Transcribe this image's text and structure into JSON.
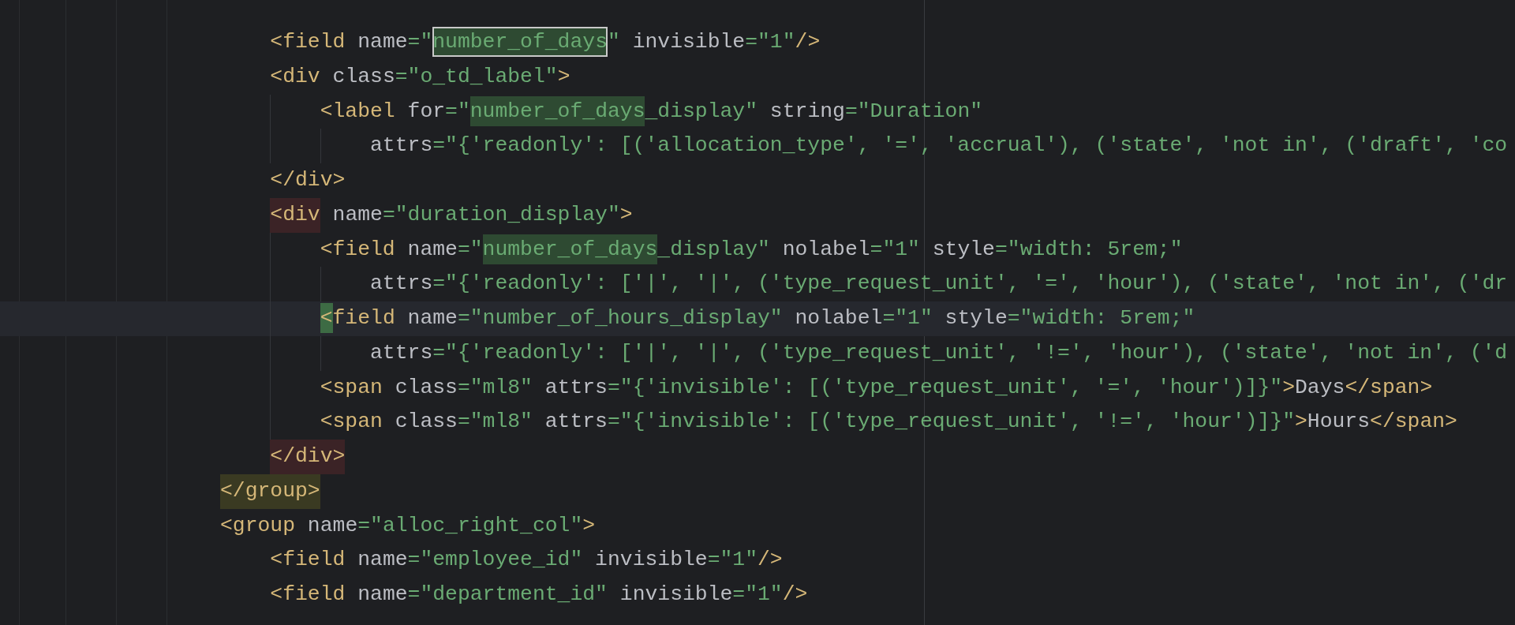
{
  "editor": {
    "lines": [
      {
        "children": [
          {
            "current": false,
            "tokens": [
              {
                "kind": "tag",
                "s": "<field"
              },
              {
                "kind": "attr",
                "s": " name"
              },
              {
                "kind": "str",
                "s": "=\""
              },
              {
                "kind": "str-match-current",
                "s": "number_of_days"
              },
              {
                "kind": "str",
                "s": "\""
              },
              {
                "kind": "attr",
                "s": " invisible"
              },
              {
                "kind": "str",
                "s": "=\"1\""
              },
              {
                "kind": "tag",
                "s": "/>"
              }
            ]
          },
          {
            "current": false,
            "tokens": [
              {
                "kind": "tag",
                "s": "<div"
              },
              {
                "kind": "attr",
                "s": " class"
              },
              {
                "kind": "str",
                "s": "=\"o_td_label\""
              },
              {
                "kind": "tag",
                "s": ">"
              }
            ],
            "children": [
              {
                "current": false,
                "tokens": [
                  {
                    "kind": "tag",
                    "s": "<label"
                  },
                  {
                    "kind": "attr",
                    "s": " for"
                  },
                  {
                    "kind": "str",
                    "s": "=\""
                  },
                  {
                    "kind": "str-match",
                    "s": "number_of_days"
                  },
                  {
                    "kind": "str",
                    "s": "_display\""
                  },
                  {
                    "kind": "attr",
                    "s": " string"
                  },
                  {
                    "kind": "str",
                    "s": "=\"Duration\""
                  }
                ],
                "children": [
                  {
                    "current": false,
                    "tokens": [
                      {
                        "kind": "attr",
                        "s": "attrs"
                      },
                      {
                        "kind": "str",
                        "s": "=\"{'readonly': [('allocation_type', '=', 'accrual'), ('state', 'not in', ('draft', 'co"
                      }
                    ]
                  }
                ]
              }
            ]
          },
          {
            "current": false,
            "tokens": [
              {
                "kind": "tag",
                "s": "</div>"
              }
            ]
          },
          {
            "current": false,
            "tokens": [
              {
                "kind": "tag-pair",
                "s": "<div"
              },
              {
                "kind": "attr",
                "s": " name"
              },
              {
                "kind": "str",
                "s": "=\"duration_display\""
              },
              {
                "kind": "tag",
                "s": ">"
              }
            ],
            "children": [
              {
                "current": false,
                "tokens": [
                  {
                    "kind": "tag",
                    "s": "<field"
                  },
                  {
                    "kind": "attr",
                    "s": " name"
                  },
                  {
                    "kind": "str",
                    "s": "=\""
                  },
                  {
                    "kind": "str-match",
                    "s": "number_of_days"
                  },
                  {
                    "kind": "str",
                    "s": "_display\""
                  },
                  {
                    "kind": "attr",
                    "s": " nolabel"
                  },
                  {
                    "kind": "str",
                    "s": "=\"1\""
                  },
                  {
                    "kind": "attr",
                    "s": " style"
                  },
                  {
                    "kind": "str",
                    "s": "=\"width: 5rem;\""
                  }
                ],
                "children": [
                  {
                    "current": false,
                    "tokens": [
                      {
                        "kind": "attr",
                        "s": "attrs"
                      },
                      {
                        "kind": "str",
                        "s": "=\"{'readonly': ['|', '|', ('type_request_unit', '=', 'hour'), ('state', 'not in', ('dr"
                      }
                    ]
                  }
                ]
              },
              {
                "current": true,
                "tokens": [
                  {
                    "kind": "tag-caret",
                    "s": "<"
                  },
                  {
                    "kind": "tag",
                    "s": "field"
                  },
                  {
                    "kind": "attr",
                    "s": " name"
                  },
                  {
                    "kind": "str",
                    "s": "=\"number_of_hours_display\""
                  },
                  {
                    "kind": "attr",
                    "s": " nolabel"
                  },
                  {
                    "kind": "str",
                    "s": "=\"1\""
                  },
                  {
                    "kind": "attr",
                    "s": " style"
                  },
                  {
                    "kind": "str",
                    "s": "=\"width: 5rem;\""
                  }
                ],
                "children": [
                  {
                    "current": false,
                    "tokens": [
                      {
                        "kind": "attr",
                        "s": "attrs"
                      },
                      {
                        "kind": "str",
                        "s": "=\"{'readonly': ['|', '|', ('type_request_unit', '!=', 'hour'), ('state', 'not in', ('d"
                      }
                    ]
                  }
                ]
              },
              {
                "current": false,
                "tokens": [
                  {
                    "kind": "tag",
                    "s": "<span"
                  },
                  {
                    "kind": "attr",
                    "s": " class"
                  },
                  {
                    "kind": "str",
                    "s": "=\"ml8\""
                  },
                  {
                    "kind": "attr",
                    "s": " attrs"
                  },
                  {
                    "kind": "str",
                    "s": "=\"{'invisible': [('type_request_unit', '=', 'hour')]}\""
                  },
                  {
                    "kind": "tag",
                    "s": ">"
                  },
                  {
                    "kind": "text",
                    "s": "Days"
                  },
                  {
                    "kind": "tag",
                    "s": "</span>"
                  }
                ]
              },
              {
                "current": false,
                "tokens": [
                  {
                    "kind": "tag",
                    "s": "<span"
                  },
                  {
                    "kind": "attr",
                    "s": " class"
                  },
                  {
                    "kind": "str",
                    "s": "=\"ml8\""
                  },
                  {
                    "kind": "attr",
                    "s": " attrs"
                  },
                  {
                    "kind": "str",
                    "s": "=\"{'invisible': [('type_request_unit', '!=', 'hour')]}\""
                  },
                  {
                    "kind": "tag",
                    "s": ">"
                  },
                  {
                    "kind": "text",
                    "s": "Hours"
                  },
                  {
                    "kind": "tag",
                    "s": "</span>"
                  }
                ]
              }
            ]
          },
          {
            "current": false,
            "tokens": [
              {
                "kind": "tag-pair",
                "s": "</div>"
              }
            ]
          }
        ]
      },
      {
        "current": false,
        "tokens": [
          {
            "kind": "tag-scope",
            "s": "</group>"
          }
        ]
      },
      {
        "current": false,
        "tokens": [
          {
            "kind": "tag",
            "s": "<group"
          },
          {
            "kind": "attr",
            "s": " name"
          },
          {
            "kind": "str",
            "s": "=\"alloc_right_col\""
          },
          {
            "kind": "tag",
            "s": ">"
          }
        ],
        "children": [
          {
            "current": false,
            "tokens": [
              {
                "kind": "tag",
                "s": "<field"
              },
              {
                "kind": "attr",
                "s": " name"
              },
              {
                "kind": "str",
                "s": "=\"employee_id\""
              },
              {
                "kind": "attr",
                "s": " invisible"
              },
              {
                "kind": "str",
                "s": "=\"1\""
              },
              {
                "kind": "tag",
                "s": "/>"
              }
            ]
          },
          {
            "current": false,
            "tokens": [
              {
                "kind": "tag",
                "s": "<field"
              },
              {
                "kind": "attr",
                "s": " name"
              },
              {
                "kind": "str",
                "s": "=\"department_id\""
              },
              {
                "kind": "attr",
                "s": " invisible"
              },
              {
                "kind": "str",
                "s": "=\"1\""
              },
              {
                "kind": "tag",
                "s": "/>"
              }
            ]
          }
        ]
      }
    ]
  }
}
